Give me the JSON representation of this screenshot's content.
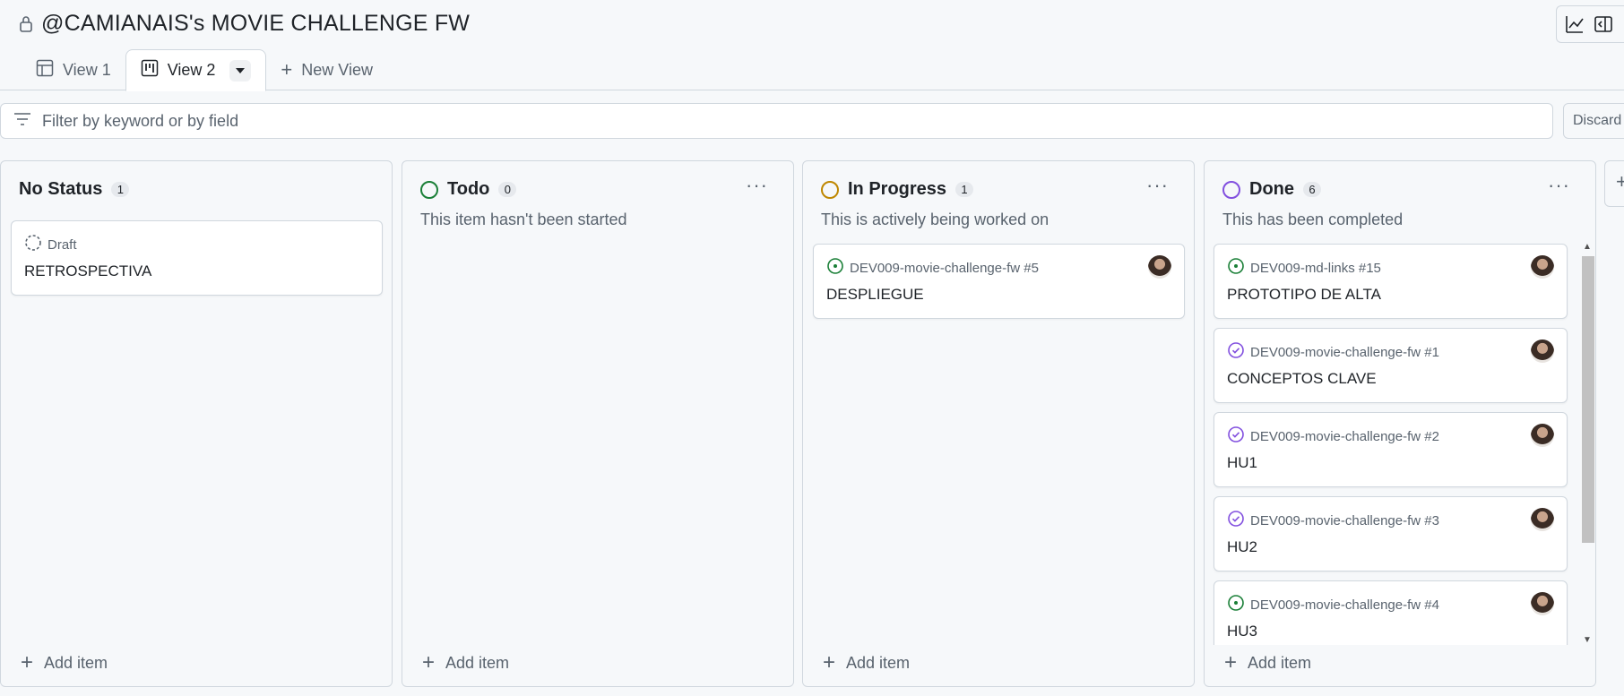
{
  "project": {
    "title": "@CAMIANAIS's MOVIE CHALLENGE FW"
  },
  "tabs": [
    {
      "label": "View 1"
    },
    {
      "label": "View 2"
    },
    {
      "label": "New View"
    }
  ],
  "filter": {
    "placeholder": "Filter by keyword or by field",
    "discard_label": "Discard"
  },
  "columns": [
    {
      "title": "No Status",
      "count": "1",
      "description": "",
      "add_label": "Add item",
      "cards": [
        {
          "meta": "Draft",
          "title": "RETROSPECTIVA"
        }
      ]
    },
    {
      "title": "Todo",
      "count": "0",
      "description": "This item hasn't been started",
      "add_label": "Add item",
      "cards": []
    },
    {
      "title": "In Progress",
      "count": "1",
      "description": "This is actively being worked on",
      "add_label": "Add item",
      "cards": [
        {
          "meta": "DEV009-movie-challenge-fw #5",
          "title": "DESPLIEGUE"
        }
      ]
    },
    {
      "title": "Done",
      "count": "6",
      "description": "This has been completed",
      "add_label": "Add item",
      "cards": [
        {
          "meta": "DEV009-md-links #15",
          "title": "PROTOTIPO DE ALTA"
        },
        {
          "meta": "DEV009-movie-challenge-fw #1",
          "title": "CONCEPTOS CLAVE"
        },
        {
          "meta": "DEV009-movie-challenge-fw #2",
          "title": "HU1"
        },
        {
          "meta": "DEV009-movie-challenge-fw #3",
          "title": "HU2"
        },
        {
          "meta": "DEV009-movie-challenge-fw #4",
          "title": "HU3"
        }
      ]
    }
  ],
  "colors": {
    "todo": "#1a7f37",
    "in_progress": "#bf8700",
    "done": "#8250df",
    "open_issue": "#1a7f37",
    "closed_issue": "#8250df"
  }
}
